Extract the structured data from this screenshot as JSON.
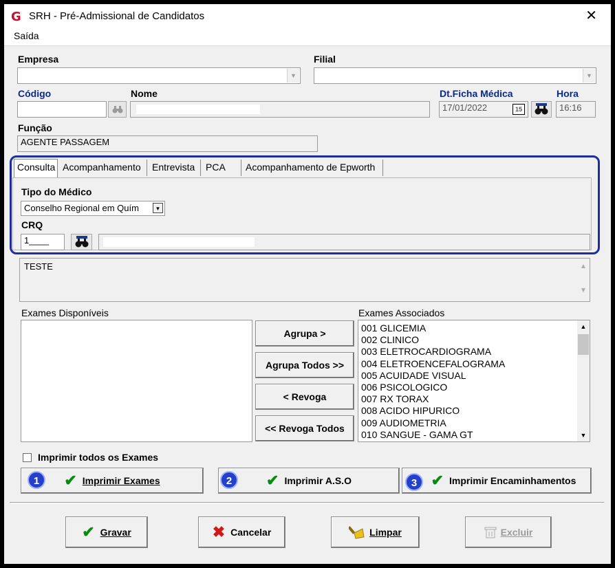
{
  "window": {
    "title": "SRH - Pré-Admissional de Candidatos",
    "close": "✕",
    "logo": "G"
  },
  "menu": {
    "items": [
      "Saída"
    ]
  },
  "empresa": {
    "label": "Empresa",
    "value": ""
  },
  "filial": {
    "label": "Filial",
    "value": ""
  },
  "codigo": {
    "label": "Código",
    "value": ""
  },
  "nome": {
    "label": "Nome",
    "value": ""
  },
  "dt_ficha": {
    "label": "Dt.Ficha Médica",
    "value": "17/01/2022",
    "calendar_icon": "15"
  },
  "hora": {
    "label": "Hora",
    "value": "16:16"
  },
  "funcao": {
    "label": "Função",
    "value": "AGENTE PASSAGEM"
  },
  "tabs": [
    {
      "label": "Consulta",
      "active": true
    },
    {
      "label": "Acompanhamento",
      "active": false
    },
    {
      "label": "Entrevista",
      "active": false
    },
    {
      "label": "PCA",
      "active": false
    },
    {
      "label": "Acompanhamento de Epworth",
      "active": false
    }
  ],
  "tipo_medico": {
    "label": "Tipo do Médico",
    "value": "Conselho Regional em Quím"
  },
  "crq": {
    "label": "CRQ",
    "value": "1____",
    "name_value": ""
  },
  "observacao": {
    "value": "TESTE"
  },
  "exames_disponiveis": {
    "label": "Exames Disponíveis",
    "items": []
  },
  "exames_associados": {
    "label": "Exames Associados",
    "items": [
      "001 GLICEMIA",
      "002 CLINICO",
      "003 ELETROCARDIOGRAMA",
      "004 ELETROENCEFALOGRAMA",
      "005 ACUIDADE VISUAL",
      "006 PSICOLOGICO",
      "007 RX TORAX",
      "008 ACIDO HIPURICO",
      "009 AUDIOMETRIA",
      "010 SANGUE - GAMA GT"
    ]
  },
  "transfer_buttons": {
    "agrupa": "Agrupa >",
    "agrupa_todos": "Agrupa Todos >>",
    "revoga": "< Revoga",
    "revoga_todos": "<< Revoga Todos"
  },
  "imprimir_todos": {
    "label": "Imprimir todos os Exames",
    "checked": false
  },
  "print_buttons": [
    {
      "badge": "1",
      "label": "Imprimir Exames"
    },
    {
      "badge": "2",
      "label": "Imprimir A.S.O"
    },
    {
      "badge": "3",
      "label": "Imprimir Encaminhamentos"
    }
  ],
  "footer_buttons": {
    "gravar": "Gravar",
    "cancelar": "Cancelar",
    "limpar": "Limpar",
    "excluir": "Excluir"
  },
  "colors": {
    "highlight": "#1e2ea0",
    "badge": "#2540c8",
    "check": "#0a8a10",
    "label_blue": "#0a2a8a",
    "logo": "#c8102e"
  }
}
